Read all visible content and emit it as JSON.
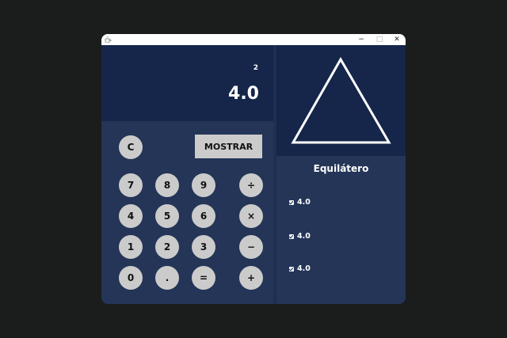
{
  "window": {
    "controls": {
      "minimize": "−",
      "maximize": "□",
      "close": "✕"
    },
    "app_icon": "java-cup-icon"
  },
  "display": {
    "expression": "2",
    "result": "4.0"
  },
  "buttons": {
    "clear": "C",
    "show": "MOSTRAR",
    "digits": {
      "seven": "7",
      "eight": "8",
      "nine": "9",
      "four": "4",
      "five": "5",
      "six": "6",
      "one": "1",
      "two": "2",
      "three": "3",
      "zero": "0",
      "dot": ".",
      "equals": "="
    },
    "ops": {
      "divide": "÷",
      "multiply": "×",
      "subtract": "−",
      "add": "+"
    }
  },
  "triangle": {
    "type": "Equilátero",
    "sides": [
      "4.0",
      "4.0",
      "4.0"
    ]
  },
  "colors": {
    "background": "#1b1c1c",
    "panel": "#243557",
    "display_panel": "#15264a",
    "button": "#cbcbcb",
    "text_light": "#ffffff"
  }
}
